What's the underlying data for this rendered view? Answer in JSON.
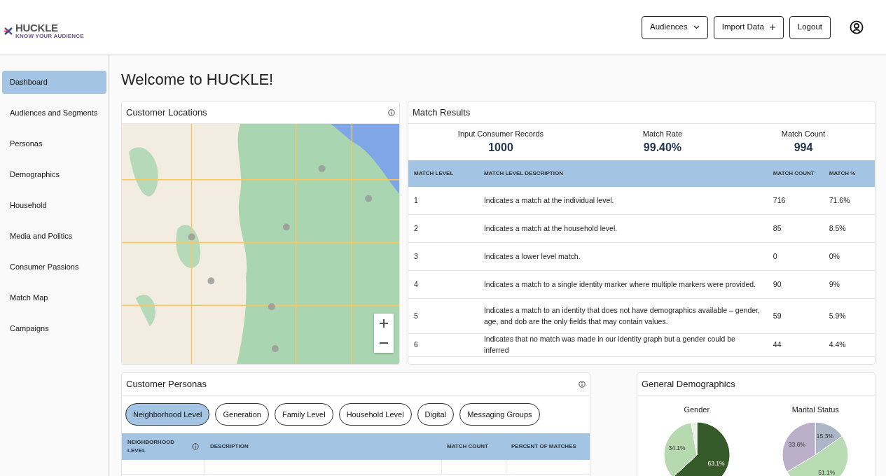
{
  "header": {
    "logo": "HUCKLE",
    "logo_tagline": "KNOW YOUR AUDIENCE",
    "buttons": [
      {
        "label": "Audiences",
        "kind": "dropdown"
      },
      {
        "label": "Import Data",
        "kind": "add"
      },
      {
        "label": "Logout",
        "kind": "plain"
      }
    ]
  },
  "sidebar": {
    "items": [
      {
        "label": "Dashboard",
        "selected": true
      },
      {
        "label": "Audiences and Segments",
        "selected": false
      },
      {
        "label": "Personas",
        "selected": false
      },
      {
        "label": "Demographics",
        "selected": false
      },
      {
        "label": "Household",
        "selected": false
      },
      {
        "label": "Media and Politics",
        "selected": false
      },
      {
        "label": "Consumer Passions",
        "selected": false
      },
      {
        "label": "Match Map",
        "selected": false
      },
      {
        "label": "Campaigns",
        "selected": false
      }
    ]
  },
  "page_title": "Welcome to HUCKLE!",
  "customer_locations": {
    "title": "Customer Locations"
  },
  "match_results": {
    "title": "Match Results",
    "stats": [
      {
        "label": "Input Consumer Records",
        "value": "1000"
      },
      {
        "label": "Match Rate",
        "value": "99.40%"
      },
      {
        "label": "Match Count",
        "value": "994"
      }
    ],
    "table": {
      "columns": [
        "MATCH LEVEL",
        "MATCH LEVEL DESCRIPTION",
        "MATCH COUNT",
        "MATCH %"
      ],
      "rows": [
        [
          "1",
          "Indicates a match at the individual level.",
          "716",
          "71.6%"
        ],
        [
          "2",
          "Indicates a match at the household level.",
          "85",
          "8.5%"
        ],
        [
          "3",
          "Indicates a lower level match.",
          "0",
          "0%"
        ],
        [
          "4",
          "Indicates a match to a single identity marker where multiple markers were provided.",
          "90",
          "9%"
        ],
        [
          "5",
          "Indicates a match to an identity that does not have demographics available – gender, age, and dob are the only fields that may contain values.",
          "59",
          "5.9%"
        ],
        [
          "6",
          "Indicates that no match was made in our identity graph but a gender could be inferred",
          "44",
          "4.4%"
        ]
      ]
    }
  },
  "customer_personas": {
    "title": "Customer Personas",
    "tabs": [
      {
        "label": "Neighborhood Level",
        "selected": true
      },
      {
        "label": "Generation",
        "selected": false
      },
      {
        "label": "Family Level",
        "selected": false
      },
      {
        "label": "Household Level",
        "selected": false
      },
      {
        "label": "Digital",
        "selected": false
      },
      {
        "label": "Messaging Groups",
        "selected": false
      }
    ],
    "table": {
      "columns": [
        "NEIGHBORHOOD LEVEL",
        "DESCRIPTION",
        "MATCH COUNT",
        "PERCENT OF MATCHES"
      ]
    }
  },
  "general_demographics": {
    "title": "General Demographics",
    "charts": [
      {
        "chart_data": {
          "type": "pie",
          "title": "Gender",
          "series": [
            {
              "values": [
                63.1,
                34.1,
                2.8
              ]
            }
          ],
          "value_labels": [
            "63.1%",
            "34.1%",
            null
          ]
        }
      },
      {
        "chart_data": {
          "type": "pie",
          "title": "Marital Status",
          "series": [
            {
              "values": [
                15.3,
                51.1,
                33.6
              ]
            }
          ],
          "value_labels": [
            "15.3%",
            "51.1%",
            "33.6%"
          ]
        }
      }
    ]
  }
}
